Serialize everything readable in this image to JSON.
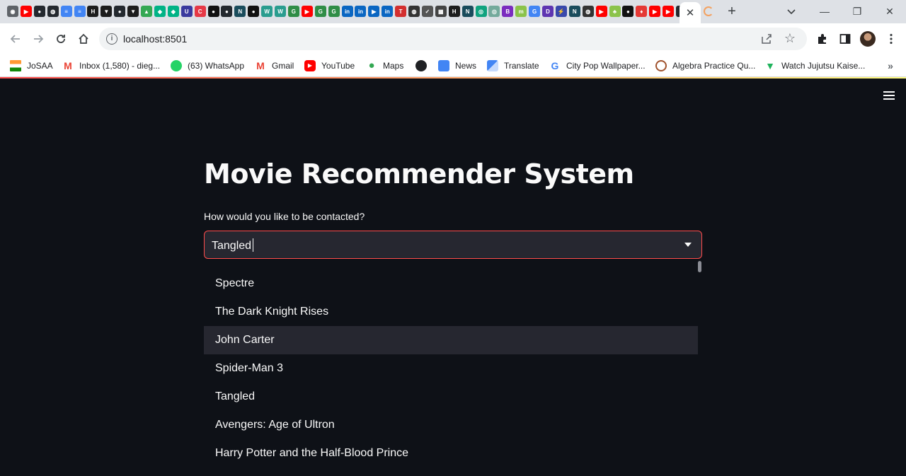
{
  "browser": {
    "tab_icons": [
      {
        "name": "chrome-icon",
        "color": "#5f6368",
        "glyph": "◉"
      },
      {
        "name": "youtube-icon",
        "color": "#ff0000",
        "glyph": "▶"
      },
      {
        "name": "github-icon",
        "color": "#24292f",
        "glyph": "●"
      },
      {
        "name": "globe-icon",
        "color": "#24292f",
        "glyph": "◍"
      },
      {
        "name": "docs-icon",
        "color": "#4285f4",
        "glyph": "≡"
      },
      {
        "name": "docs-icon",
        "color": "#4285f4",
        "glyph": "≡"
      },
      {
        "name": "hackerrank-icon",
        "color": "#1d1d1d",
        "glyph": "H"
      },
      {
        "name": "mask-icon",
        "color": "#1d1d1d",
        "glyph": "▼"
      },
      {
        "name": "github-icon",
        "color": "#24292f",
        "glyph": "●"
      },
      {
        "name": "mask-icon",
        "color": "#1d1d1d",
        "glyph": "▼"
      },
      {
        "name": "drive-icon",
        "color": "#34a853",
        "glyph": "▲"
      },
      {
        "name": "vedantu-icon",
        "color": "#00b386",
        "glyph": "◆"
      },
      {
        "name": "vedantu-icon",
        "color": "#00b386",
        "glyph": "◆"
      },
      {
        "name": "unacademy-icon",
        "color": "#3a3a9e",
        "glyph": "U"
      },
      {
        "name": "coding-icon",
        "color": "#e63946",
        "glyph": "C"
      },
      {
        "name": "medium-icon",
        "color": "#111111",
        "glyph": "●"
      },
      {
        "name": "github-icon",
        "color": "#24292f",
        "glyph": "●"
      },
      {
        "name": "notion-icon",
        "color": "#1a4c5c",
        "glyph": "N"
      },
      {
        "name": "medium-icon",
        "color": "#111111",
        "glyph": "●"
      },
      {
        "name": "webflow-icon",
        "color": "#2a9d8f",
        "glyph": "W"
      },
      {
        "name": "webflow-icon",
        "color": "#2a9d8f",
        "glyph": "W"
      },
      {
        "name": "geeksforgeeks-icon",
        "color": "#2f8d46",
        "glyph": "G"
      },
      {
        "name": "youtube-icon",
        "color": "#ff0000",
        "glyph": "▶"
      },
      {
        "name": "geeksforgeeks-icon",
        "color": "#2f8d46",
        "glyph": "G"
      },
      {
        "name": "geeksforgeeks-icon",
        "color": "#2f8d46",
        "glyph": "G"
      },
      {
        "name": "linkedin-icon",
        "color": "#0a66c2",
        "glyph": "in"
      },
      {
        "name": "linkedin-icon",
        "color": "#0a66c2",
        "glyph": "in"
      },
      {
        "name": "play-icon",
        "color": "#0a66c2",
        "glyph": "▶"
      },
      {
        "name": "linkedin-icon",
        "color": "#0a66c2",
        "glyph": "in"
      },
      {
        "name": "tg-icon",
        "color": "#d32f2f",
        "glyph": "T"
      },
      {
        "name": "globe-icon",
        "color": "#333333",
        "glyph": "◍"
      },
      {
        "name": "check-icon",
        "color": "#555555",
        "glyph": "✓"
      },
      {
        "name": "grid-icon",
        "color": "#444444",
        "glyph": "▦"
      },
      {
        "name": "hackerrank-icon",
        "color": "#1d1d1d",
        "glyph": "H"
      },
      {
        "name": "notion-icon",
        "color": "#1a4c5c",
        "glyph": "N"
      },
      {
        "name": "openai-icon",
        "color": "#10a37f",
        "glyph": "◎"
      },
      {
        "name": "openai-icon",
        "color": "#74aa9c",
        "glyph": "◎"
      },
      {
        "name": "purple-icon",
        "color": "#7b2cbf",
        "glyph": "B"
      },
      {
        "name": "mb-icon",
        "color": "#8bc34a",
        "glyph": "m"
      },
      {
        "name": "google-icon",
        "color": "#4285f4",
        "glyph": "G"
      },
      {
        "name": "d-icon",
        "color": "#5e35b1",
        "glyph": "D"
      },
      {
        "name": "bolt-icon",
        "color": "#3949ab",
        "glyph": "⚡"
      },
      {
        "name": "notion-icon",
        "color": "#1a4c5c",
        "glyph": "N"
      },
      {
        "name": "globe-icon",
        "color": "#333333",
        "glyph": "◍"
      },
      {
        "name": "youtube-icon",
        "color": "#ff0000",
        "glyph": "▶"
      },
      {
        "name": "plant-icon",
        "color": "#8bc34a",
        "glyph": "♣"
      },
      {
        "name": "medium-icon",
        "color": "#111111",
        "glyph": "●"
      },
      {
        "name": "rose-icon",
        "color": "#e53935",
        "glyph": "♦"
      },
      {
        "name": "youtube-icon",
        "color": "#ff0000",
        "glyph": "▶"
      },
      {
        "name": "youtube-icon",
        "color": "#ff0000",
        "glyph": "▶"
      },
      {
        "name": "github-icon",
        "color": "#24292f",
        "glyph": "●"
      }
    ],
    "active_tab_close": "✕",
    "new_tab": "+",
    "window_minimize": "—",
    "window_restore": "❐",
    "window_close": "✕",
    "url": "localhost:8501"
  },
  "bookmarks": [
    {
      "label": "JoSAA",
      "icon": "india-flag-icon",
      "color": "#ff9933"
    },
    {
      "label": "Inbox (1,580) - dieg...",
      "icon": "gmail-icon",
      "color": "#ea4335"
    },
    {
      "label": "(63) WhatsApp",
      "icon": "whatsapp-icon",
      "color": "#25d366"
    },
    {
      "label": "Gmail",
      "icon": "gmail-icon",
      "color": "#ea4335"
    },
    {
      "label": "YouTube",
      "icon": "youtube-icon",
      "color": "#ff0000"
    },
    {
      "label": "Maps",
      "icon": "maps-icon",
      "color": "#34a853"
    },
    {
      "label": "",
      "icon": "globe-icon",
      "color": "#202124"
    },
    {
      "label": "News",
      "icon": "news-icon",
      "color": "#4285f4"
    },
    {
      "label": "Translate",
      "icon": "translate-icon",
      "color": "#4285f4"
    },
    {
      "label": "City Pop Wallpaper...",
      "icon": "google-icon",
      "color": "#4285f4"
    },
    {
      "label": "Algebra Practice Qu...",
      "icon": "brilliant-icon",
      "color": "#a0522d"
    },
    {
      "label": "Watch Jujutsu Kaise...",
      "icon": "crunchy-icon",
      "color": "#1fb35c"
    }
  ],
  "bookmarks_overflow": "»",
  "app": {
    "title": "Movie Recommender System",
    "select_label": "How would you like to be contacted?",
    "select_value": "Tangled",
    "options": [
      "Spectre",
      "The Dark Knight Rises",
      "John Carter",
      "Spider-Man 3",
      "Tangled",
      "Avengers: Age of Ultron",
      "Harry Potter and the Half-Blood Prince"
    ],
    "highlighted_option": "John Carter"
  }
}
